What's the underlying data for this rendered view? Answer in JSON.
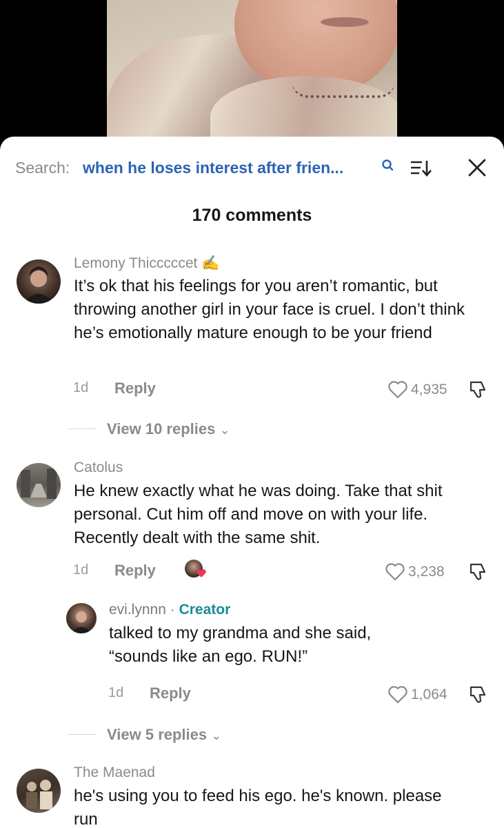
{
  "search": {
    "label": "Search:",
    "query": "when he loses interest after frien..."
  },
  "comments_count": "170 comments",
  "comments": [
    {
      "username": "Lemony Thicccccet",
      "username_emoji": "✍",
      "text": "It’s ok that his feelings for you aren’t romantic, but throwing another girl in your face is cruel. I don’t think he’s emotionally mature enough to be your friend",
      "time": "1d",
      "reply_label": "Reply",
      "likes": "4,935",
      "view_replies": "View 10 replies"
    },
    {
      "username": "Catolus",
      "text": "He knew exactly what he was doing. Take that shit personal. Cut him off and move on with your life. Recently dealt with the same shit.",
      "time": "1d",
      "reply_label": "Reply",
      "likes": "3,238",
      "reply": {
        "username": "evi.lynnn",
        "separator": "·",
        "badge": "Creator",
        "text": "talked to my grandma and she said, “sounds like an ego. RUN!”",
        "time": "1d",
        "reply_label": "Reply",
        "likes": "1,064"
      },
      "view_replies": "View 5 replies"
    },
    {
      "username": "The Maenad",
      "text": "he's using you to feed his ego. he's known. please run"
    }
  ],
  "colors": {
    "search_query": "#2b63b5",
    "creator_badge": "#1a8b97",
    "liked_heart": "#e8395a"
  }
}
